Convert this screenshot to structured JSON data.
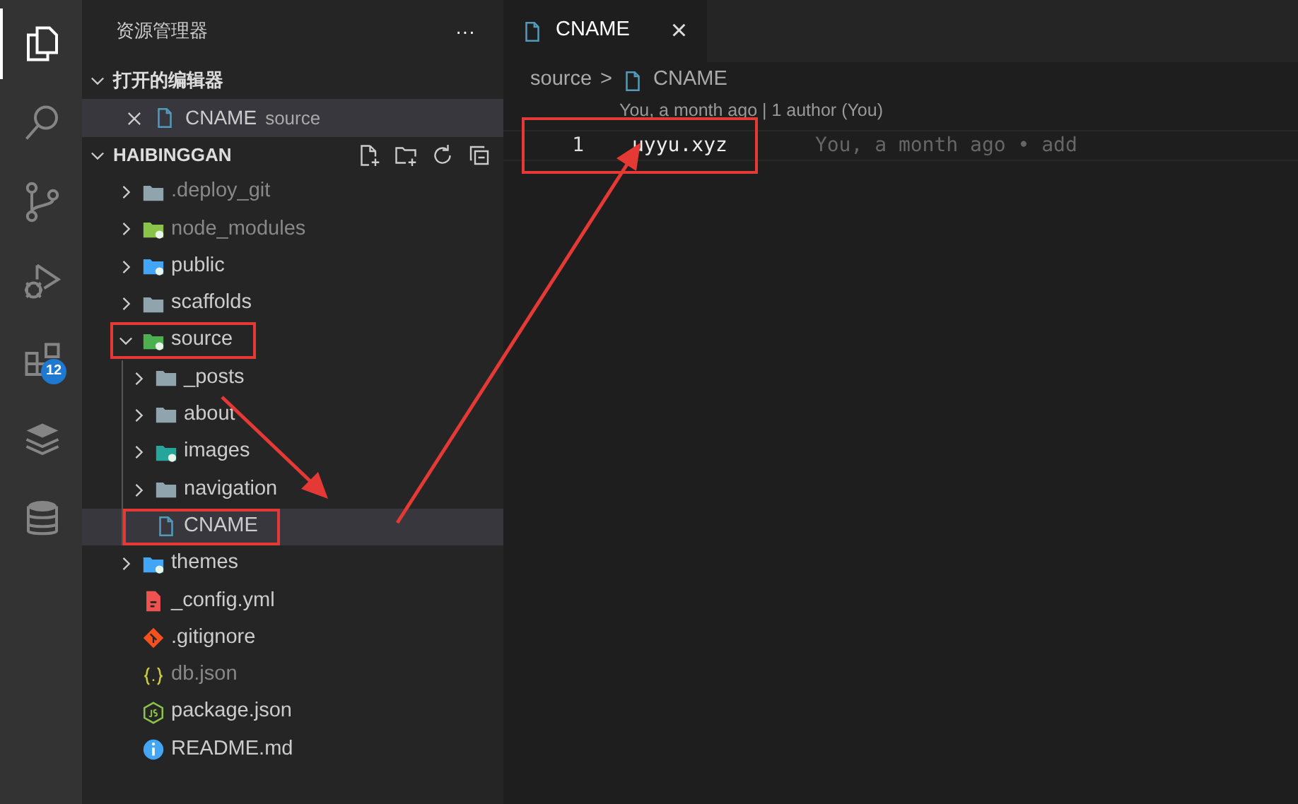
{
  "activity_bar": {
    "items": [
      {
        "kind": "explorer",
        "selected": true
      },
      {
        "kind": "search",
        "selected": false
      },
      {
        "kind": "git",
        "selected": false
      },
      {
        "kind": "debug",
        "selected": false
      },
      {
        "kind": "extensions",
        "selected": false,
        "badge": "12"
      },
      {
        "kind": "stack",
        "selected": false
      },
      {
        "kind": "database",
        "selected": false
      }
    ]
  },
  "sidebar": {
    "title": "资源管理器",
    "more": "···",
    "open_editors": {
      "title": "打开的编辑器",
      "expanded": true,
      "items": [
        {
          "name": "CNAME",
          "folder": "source",
          "selected": true
        }
      ]
    },
    "project": {
      "title": "HAIBINGGAN",
      "expanded": true,
      "tree": [
        {
          "name": ".deploy_git",
          "kind": "folder",
          "expanded": false,
          "ignored": true,
          "selected": false,
          "highlighted": false
        },
        {
          "name": "node_modules",
          "kind": "folder",
          "color": "#8bc34a",
          "expanded": false,
          "ignored": true,
          "selected": false,
          "highlighted": false
        },
        {
          "name": "public",
          "kind": "folder",
          "color": "#42a5f5",
          "expanded": false,
          "ignored": false,
          "selected": false,
          "highlighted": false
        },
        {
          "name": "scaffolds",
          "kind": "folder",
          "expanded": false,
          "ignored": false,
          "selected": false,
          "highlighted": false
        },
        {
          "name": "source",
          "kind": "folder",
          "color": "#4caf50",
          "expanded": true,
          "ignored": false,
          "selected": false,
          "highlighted": true,
          "children": [
            {
              "name": "_posts",
              "kind": "folder",
              "expanded": false,
              "ignored": false,
              "selected": false,
              "highlighted": false
            },
            {
              "name": "about",
              "kind": "folder",
              "expanded": false,
              "ignored": false,
              "selected": false,
              "highlighted": false
            },
            {
              "name": "images",
              "kind": "folder",
              "color": "#26a69a",
              "expanded": false,
              "ignored": false,
              "selected": false,
              "highlighted": false
            },
            {
              "name": "navigation",
              "kind": "folder",
              "expanded": false,
              "ignored": false,
              "selected": false,
              "highlighted": false
            },
            {
              "name": "CNAME",
              "kind": "file",
              "ignored": false,
              "selected": true,
              "highlighted": true
            }
          ]
        },
        {
          "name": "themes",
          "kind": "folder",
          "color": "#42a5f5",
          "expanded": false,
          "ignored": false,
          "selected": false,
          "highlighted": false
        },
        {
          "name": "_config.yml",
          "kind": "config",
          "ignored": false,
          "selected": false,
          "highlighted": false
        },
        {
          "name": ".gitignore",
          "kind": "git",
          "ignored": false,
          "selected": false,
          "highlighted": false
        },
        {
          "name": "db.json",
          "kind": "json",
          "ignored": true,
          "selected": false,
          "highlighted": false
        },
        {
          "name": "package.json",
          "kind": "npm",
          "ignored": false,
          "selected": false,
          "highlighted": false
        },
        {
          "name": "README.md",
          "kind": "info",
          "ignored": false,
          "selected": false,
          "highlighted": false
        }
      ]
    }
  },
  "editor": {
    "tabs": [
      {
        "label": "CNAME",
        "selected": true,
        "close": "×"
      }
    ],
    "breadcrumb": {
      "folder": "source",
      "separator": ">",
      "file": "CNAME"
    },
    "codelens": "You, a month ago | 1 author (You)",
    "lines": [
      {
        "number": "1",
        "code": "uyyu.xyz",
        "blame": "You, a month ago • add",
        "highlighted": true
      }
    ]
  }
}
